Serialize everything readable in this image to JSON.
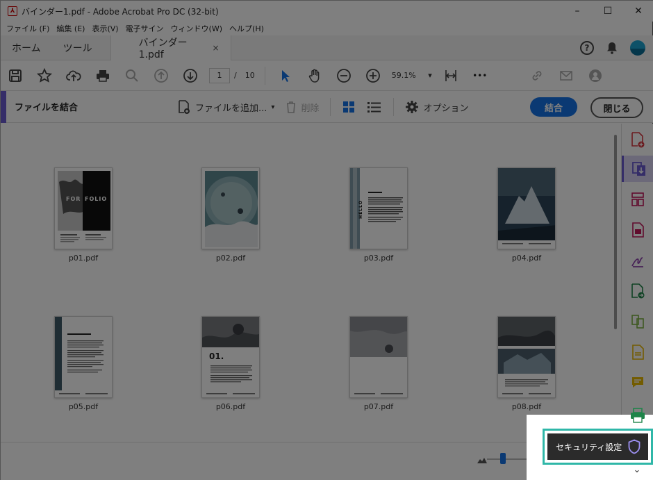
{
  "window": {
    "title": "バインダー1.pdf - Adobe Acrobat Pro DC (32-bit)",
    "app_icon": "pdf-icon",
    "controls": [
      "–",
      "☐",
      "✕"
    ]
  },
  "menu": [
    "ファイル (F)",
    "編集 (E)",
    "表示(V)",
    "電子サイン",
    "ウィンドウ(W)",
    "ヘルプ(H)"
  ],
  "tabs": {
    "home": "ホーム",
    "tools": "ツール",
    "document": "バインダー1.pdf",
    "close": "×"
  },
  "toolbar": {
    "page_current": "1",
    "page_separator": "/",
    "page_total": "10",
    "zoom": "59.1%",
    "more": "•••"
  },
  "combine": {
    "title": "ファイルを結合",
    "add_files": "ファイルを追加...",
    "delete": "削除",
    "options": "オプション",
    "combine_button": "結合",
    "close_button": "閉じる",
    "accent_color": "#6b5bd1",
    "primary_color": "#1473e6"
  },
  "files": [
    {
      "name": "p01.pdf"
    },
    {
      "name": "p02.pdf"
    },
    {
      "name": "p03.pdf"
    },
    {
      "name": "p04.pdf"
    },
    {
      "name": "p05.pdf"
    },
    {
      "name": "p06.pdf"
    },
    {
      "name": "p07.pdf"
    },
    {
      "name": "p08.pdf"
    }
  ],
  "thumb_text": {
    "p01_banner": "FOLIO",
    "p01_left": "FOR",
    "p03_side": "HELLO",
    "p06_number": "01."
  },
  "tooltip": {
    "label": "セキュリティ設定",
    "highlight_color": "#2fb7a8"
  }
}
